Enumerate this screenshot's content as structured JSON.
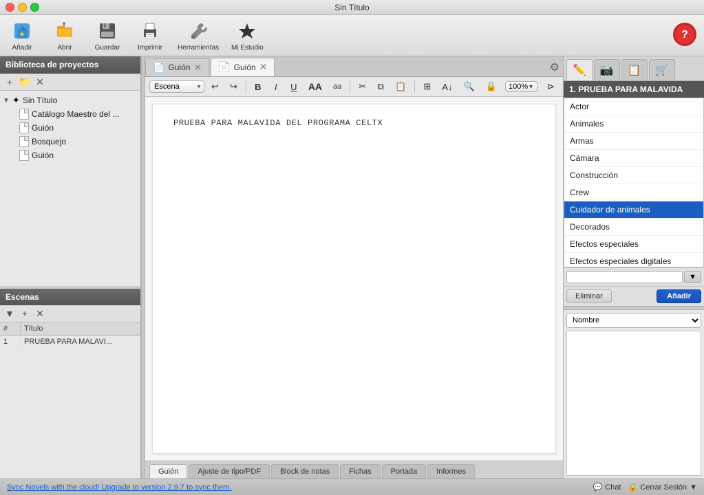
{
  "window": {
    "title": "Sin Título"
  },
  "toolbar": {
    "add_label": "Añadir",
    "open_label": "Abrir",
    "save_label": "Guardar",
    "print_label": "Imprimir",
    "tools_label": "Herramientas",
    "mystudio_label": "Mi Estudio"
  },
  "sidebar": {
    "library_title": "Biblioteca de proyectos",
    "project_name": "Sin Título",
    "project_children": [
      {
        "label": "Catálogo Maestro del ...",
        "type": "doc"
      },
      {
        "label": "Guión",
        "type": "doc"
      },
      {
        "label": "Bosquejo",
        "type": "doc"
      },
      {
        "label": "Guión",
        "type": "doc"
      }
    ]
  },
  "scenes": {
    "title": "Escenas",
    "columns": {
      "num": "#",
      "title": "Título"
    },
    "rows": [
      {
        "num": "1",
        "title": "PRUEBA PARA MALAVI..."
      }
    ]
  },
  "editor": {
    "tabs": [
      {
        "label": "Guión",
        "active": false
      },
      {
        "label": "Guión",
        "active": true
      }
    ],
    "format_select": "Escena",
    "zoom": "100%",
    "script_content": "PRUEBA PARA MALAVIDA DEL PROGRAMA CELTX"
  },
  "bottom_tabs": [
    {
      "label": "Guión",
      "active": true
    },
    {
      "label": "Ajuste de tipo/PDF",
      "active": false
    },
    {
      "label": "Block de notas",
      "active": false
    },
    {
      "label": "Fichas",
      "active": false
    },
    {
      "label": "Portada",
      "active": false
    },
    {
      "label": "Informes",
      "active": false
    }
  ],
  "right_panel": {
    "scene_title": "1. PRUEBA PARA MALAVIDA",
    "list_items": [
      {
        "label": "Actor",
        "selected": false
      },
      {
        "label": "Animales",
        "selected": false
      },
      {
        "label": "Armas",
        "selected": false
      },
      {
        "label": "Cámara",
        "selected": false
      },
      {
        "label": "Construcción",
        "selected": false
      },
      {
        "label": "Crew",
        "selected": false
      },
      {
        "label": "Cuidador de animales",
        "selected": true
      },
      {
        "label": "Decorados",
        "selected": false
      },
      {
        "label": "Efectos especiales",
        "selected": false
      },
      {
        "label": "Efectos especiales digitales",
        "selected": false
      }
    ],
    "delete_label": "Eliminar",
    "add_label": "Añadir",
    "nombre_select": "Nombre",
    "tabs": [
      {
        "icon": "✏️",
        "title": "edit"
      },
      {
        "icon": "📷",
        "title": "camera"
      },
      {
        "icon": "📋",
        "title": "list"
      },
      {
        "icon": "🛒",
        "title": "shop"
      }
    ]
  },
  "status_bar": {
    "sync_text": "Sync Novels with the cloud! Upgrade to version 2.9.7 to sync them.",
    "chat_label": "Chat",
    "session_label": "Cerrar Sesión"
  }
}
